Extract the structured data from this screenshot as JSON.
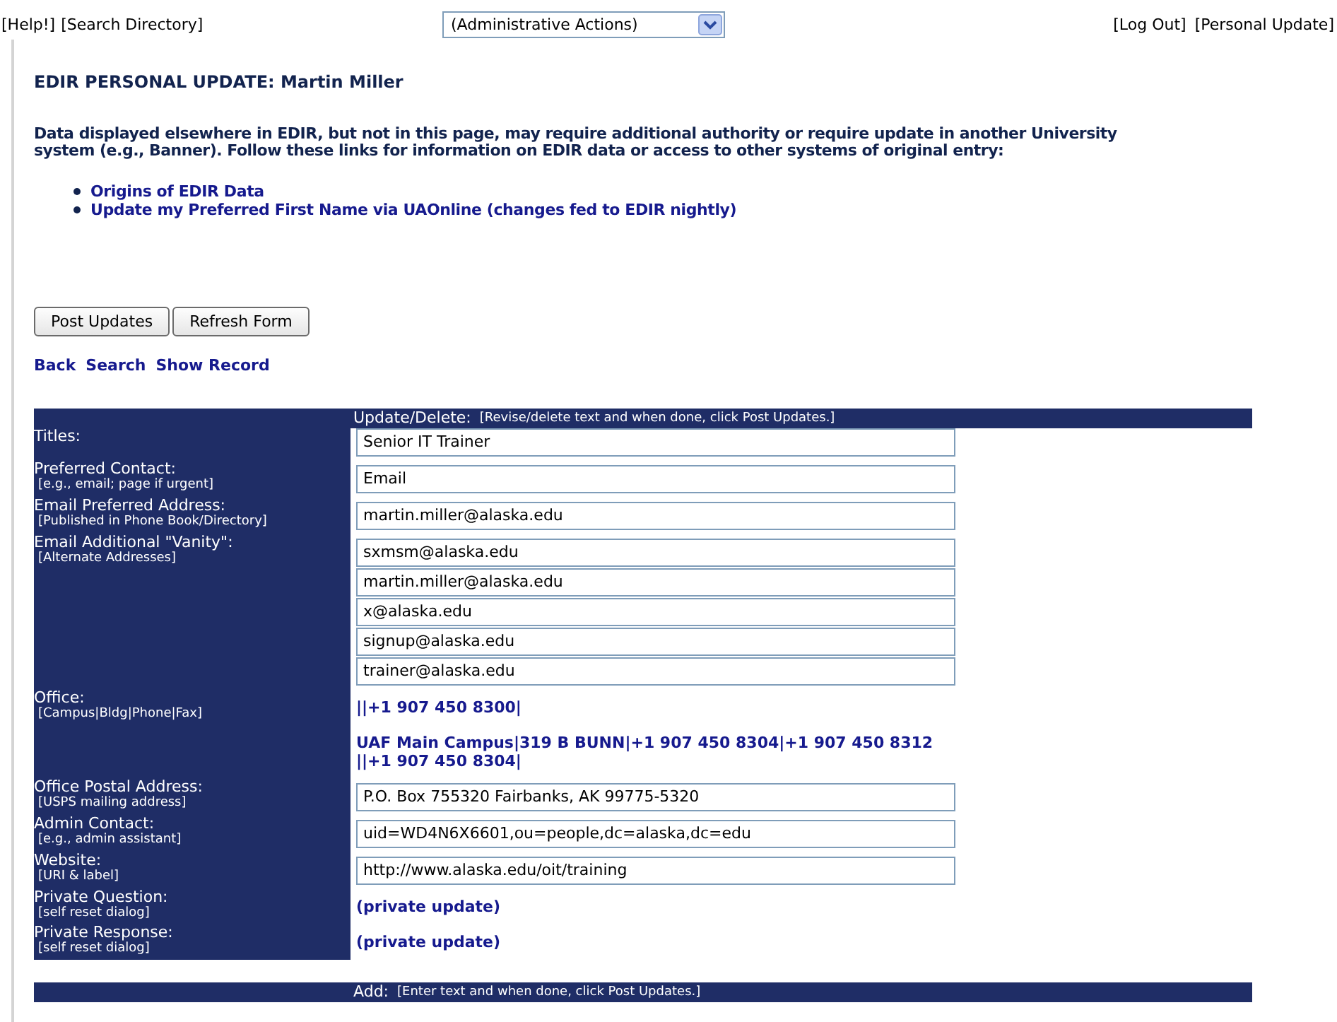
{
  "top_links": [
    "[Help!]",
    "[Search Directory]"
  ],
  "actions_dropdown": {
    "value": "(Administrative Actions)"
  },
  "account_links": [
    "[Log Out]",
    "[Personal Update]"
  ],
  "title": "EDIR PERSONAL UPDATE: Martin Miller",
  "notice": "Data displayed elsewhere in EDIR, but not in this page, may require additional authority or require update in another University system (e.g., Banner). Follow these links for information on EDIR data or access to other systems of original entry:",
  "info_links": [
    "Origins of EDIR Data",
    "Update my Preferred First Name via UAOnline (changes fed to EDIR nightly)"
  ],
  "buttons": [
    "Post Updates",
    "Refresh Form"
  ],
  "nav_links": [
    "Back",
    "Search",
    "Show Record"
  ],
  "update_section": {
    "heading": "Update/Delete:",
    "hint": "[Revise/delete text and when done, click Post Updates.]"
  },
  "fields": [
    {
      "label": "Titles:",
      "entries": [
        {
          "kind": "input",
          "value": "Senior IT Trainer"
        }
      ]
    },
    {
      "label": "Preferred Contact:",
      "hint": "[e.g., email; page if urgent]",
      "entries": [
        {
          "kind": "input",
          "value": "Email"
        }
      ]
    },
    {
      "label": "Email Preferred Address:",
      "hint": "[Published in Phone Book/Directory]",
      "entries": [
        {
          "kind": "input",
          "value": "martin.miller@alaska.edu"
        }
      ]
    },
    {
      "label": "Email Additional \"Vanity\":",
      "hint": "[Alternate Addresses]",
      "entries": [
        {
          "kind": "input",
          "value": "sxmsm@alaska.edu"
        },
        {
          "kind": "input",
          "value": "martin.miller@alaska.edu"
        },
        {
          "kind": "input",
          "value": "x@alaska.edu"
        },
        {
          "kind": "input",
          "value": "signup@alaska.edu"
        },
        {
          "kind": "input",
          "value": "trainer@alaska.edu"
        }
      ]
    },
    {
      "label": "Office:",
      "hint": "[Campus|Bldg|Phone|Fax]",
      "entries": [
        {
          "kind": "link",
          "lines": [
            "||+1 907 450 8300|"
          ]
        }
      ]
    },
    {
      "entries": [
        {
          "kind": "link",
          "lines": [
            "UAF Main Campus|319 B BUNN|+1 907 450 8304|+1 907 450 8312",
            "||+1 907 450 8304|"
          ]
        }
      ]
    },
    {
      "label": "Office Postal Address:",
      "hint": "[USPS mailing address]",
      "entries": [
        {
          "kind": "input",
          "value": "P.O. Box 755320 Fairbanks, AK 99775-5320"
        }
      ]
    },
    {
      "label": "Admin Contact:",
      "hint": "[e.g., admin assistant]",
      "entries": [
        {
          "kind": "input",
          "value": "uid=WD4N6X6601,ou=people,dc=alaska,dc=edu"
        }
      ]
    },
    {
      "label": "Website:",
      "hint": "[URI & label]",
      "entries": [
        {
          "kind": "input",
          "value": "http://www.alaska.edu/oit/training"
        }
      ]
    },
    {
      "label": "Private Question:",
      "hint": "[self reset dialog]",
      "entries": [
        {
          "kind": "link",
          "lines": [
            "(private update)"
          ]
        }
      ]
    },
    {
      "label": "Private Response:",
      "hint": "[self reset dialog]",
      "entries": [
        {
          "kind": "link",
          "lines": [
            "(private update)"
          ]
        }
      ]
    }
  ],
  "add_section": {
    "heading": "Add:",
    "hint": "[Enter text and when done, click Post Updates.]"
  }
}
